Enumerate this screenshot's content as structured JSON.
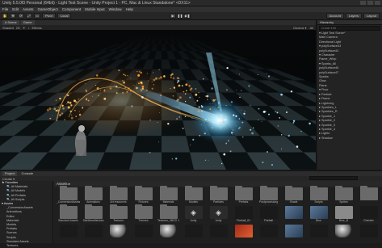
{
  "window": {
    "title": "Unity 5.5.0f3 Personal (64bit) - Light Test Scene - Unity Project 1 - PC, Mac & Linux Standalone* <DX11>"
  },
  "menu": [
    "File",
    "Edit",
    "Assets",
    "GameObject",
    "Component",
    "Mobile Input",
    "Window",
    "Help"
  ],
  "toolbar": {
    "tools": [
      "✋",
      "✥",
      "⟳",
      "⤢",
      "▭"
    ],
    "pivot": "Pivot",
    "space": "Local",
    "play": "▶",
    "pause": "❚❚",
    "step": "▶❚",
    "account": "Account",
    "layers": "Layers",
    "layout": "Layout"
  },
  "scene": {
    "tabs": [
      "# Scene",
      "Game"
    ],
    "toolbar_left": [
      "Shaded",
      "2D",
      "☀",
      "♪",
      "Effects"
    ],
    "toolbar_right": [
      "Gizmos ▾",
      "All"
    ]
  },
  "hierarchy": {
    "tab": "Hierarchy",
    "search": "Create ▾  All",
    "items": [
      "▾ Light Test Scene*",
      "   Main Camera",
      "   Directional Light",
      "  ▾ polySurface43",
      "     polySurface44",
      "   ▾ Character",
      "      Flame_Whip",
      "     ▾ Sparks_All",
      "        polySurface46",
      "        polySurface47",
      "        Sparks",
      "     Glow",
      "     Plane",
      "   ▾ Floor",
      "     ▸ Particle",
      "   ▸ Flame",
      "   ▸ Lightning",
      "   ▸ Sparkles_L",
      "   ▸ Sparkles_R",
      "   ▸ Sparkle_1",
      "   ▸ Sparkle_2",
      "   ▸ Sparkle_3",
      "   ▸ Sparkle_4",
      "   ▸ Lights",
      "   ▸ Shadow"
    ]
  },
  "project": {
    "tabs": [
      "Project",
      "Console"
    ],
    "toolbar": [
      "Create ▾"
    ],
    "search": "",
    "breadcrumb": "Assets ▸",
    "favorites_header": "★ Favorites",
    "favorites": [
      "All Materials",
      "All Models",
      "All Prefabs",
      "All Scripts"
    ],
    "assets_header": "▾ Assets",
    "folders": [
      "_ConversionAssets",
      "Animations",
      "Editor",
      "Materials",
      "Models",
      "Prefabs",
      "Scenes",
      "Scripts",
      "Standard Assets",
      "Textures"
    ],
    "grid_row1": [
      {
        "label": "_ConversionAssets",
        "kind": "folder"
      },
      {
        "label": "Animations",
        "kind": "folder"
      },
      {
        "label": "Art resources",
        "kind": "folder"
      },
      {
        "label": "Fixtures",
        "kind": "folder"
      },
      {
        "label": "Materials",
        "kind": "folder"
      },
      {
        "label": "Models",
        "kind": "folder"
      },
      {
        "label": "Particles",
        "kind": "folder"
      },
      {
        "label": "Prefabs",
        "kind": "folder"
      },
      {
        "label": "Postprocessing",
        "kind": "folder"
      },
      {
        "label": "Shade",
        "kind": "folder"
      },
      {
        "label": "Scripts",
        "kind": "folder"
      },
      {
        "label": "Sprites",
        "kind": "folder"
      },
      {
        "label": "",
        "kind": "folder"
      }
    ],
    "grid_row2": [
      {
        "label": "Standard Assets",
        "kind": "folder"
      },
      {
        "label": "StarWarsMeshes",
        "kind": "folder"
      },
      {
        "label": "Textures",
        "kind": "folder"
      },
      {
        "label": "Themes",
        "kind": "folder"
      },
      {
        "label": "Textures_XBOX 1",
        "kind": "folder"
      },
      {
        "label": "Unity",
        "kind": "unity"
      },
      {
        "label": "Unity",
        "kind": "unity"
      },
      {
        "label": "Fireball_01",
        "kind": "dark"
      },
      {
        "label": "Fireball",
        "kind": "dark"
      },
      {
        "label": "",
        "kind": "image"
      },
      {
        "label": "Blue",
        "kind": "image"
      },
      {
        "label": "Blue_B",
        "kind": "gray"
      },
      {
        "label": "Checker",
        "kind": "dark"
      }
    ],
    "grid_row3": [
      {
        "label": "",
        "kind": "dark"
      },
      {
        "label": "",
        "kind": "dark"
      },
      {
        "label": "",
        "kind": "sphere"
      },
      {
        "label": "",
        "kind": "dark"
      },
      {
        "label": "",
        "kind": "sphere"
      },
      {
        "label": "",
        "kind": "dark"
      },
      {
        "label": "",
        "kind": "dark"
      },
      {
        "label": "",
        "kind": "red"
      },
      {
        "label": "",
        "kind": "dark"
      },
      {
        "label": "",
        "kind": "image"
      },
      {
        "label": "",
        "kind": "dark"
      },
      {
        "label": "",
        "kind": "sphere"
      },
      {
        "label": "",
        "kind": "dark"
      }
    ]
  },
  "colors": {
    "accent_blue": "#7fd6ff",
    "fire_orange": "#ffb347",
    "panel_bg": "#232323"
  }
}
